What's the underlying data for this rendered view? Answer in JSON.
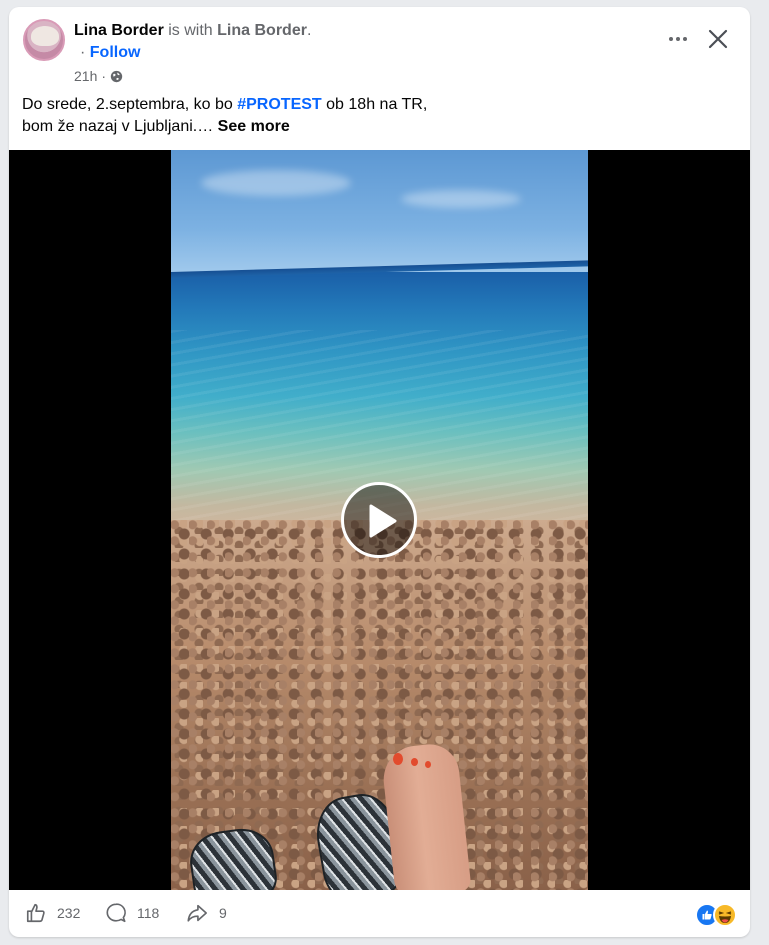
{
  "post": {
    "author": "Lina Border",
    "with_text": "is with",
    "tagged": "Lina Border",
    "tagged_suffix": ".",
    "follow_dot": "·",
    "follow_label": "Follow",
    "time": "21h",
    "time_dot": "·",
    "privacy_icon": "globe-icon",
    "text_part1": "Do srede, 2.septembra, ko bo",
    "hashtag": "#PROTEST",
    "text_part2": "ob 18h na TR,",
    "text_line2": "bom že nazaj v Ljubljani.…",
    "see_more": "See more"
  },
  "video": {
    "play_icon": "play-icon"
  },
  "stats": {
    "likes": "232",
    "comments": "118",
    "shares": "9",
    "reaction_icons": [
      "like-icon",
      "haha-icon"
    ]
  },
  "colors": {
    "accent": "#0866ff",
    "secondary_text": "#65676b",
    "like_blue": "#1877f2",
    "haha_yellow": "#f7b928"
  }
}
